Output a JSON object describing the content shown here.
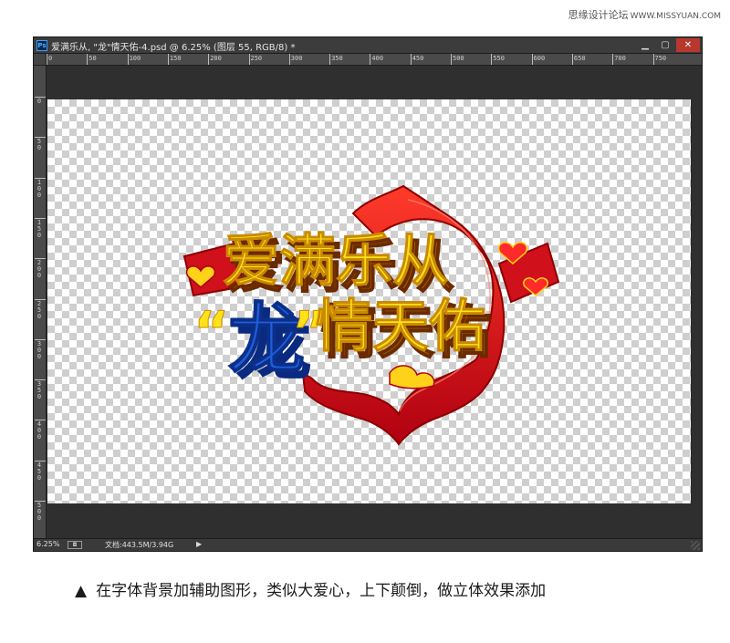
{
  "watermark": {
    "site": "思缘设计论坛",
    "url": "WWW.MISSYUAN.COM"
  },
  "window": {
    "icon_text": "Ps",
    "title": "爱满乐从, \"龙\"情天佑-4.psd @ 6.25% (图层 55, RGB/8) *",
    "buttons": {
      "minimize": "▁",
      "maximize": "▢",
      "close": "✕"
    }
  },
  "ruler": {
    "h_ticks": [
      "0",
      "50",
      "100",
      "150",
      "200",
      "250",
      "300",
      "350",
      "400",
      "450",
      "500",
      "550",
      "600",
      "650",
      "700",
      "750"
    ],
    "v_ticks": [
      "0",
      "50",
      "100",
      "150",
      "200",
      "250",
      "300",
      "350",
      "400",
      "450",
      "500"
    ]
  },
  "artwork": {
    "line1": "爱满乐从",
    "line2_prefix": "“",
    "line2_dragon": "龙",
    "line2_suffix": "”",
    "line2": "情天佑",
    "colors": {
      "text": "#ffe21a",
      "extrude": "#c98a00",
      "frame": "#e0121c",
      "dragon": "#1e5fd8",
      "outline": "#8b0000"
    }
  },
  "statusbar": {
    "zoom": "6.25%",
    "doc_info": "文档:443.5M/3.94G",
    "arrow": "▶"
  },
  "caption": {
    "marker": "▲",
    "text": "在字体背景加辅助图形，类似大爱心，上下颠倒，做立体效果添加"
  }
}
